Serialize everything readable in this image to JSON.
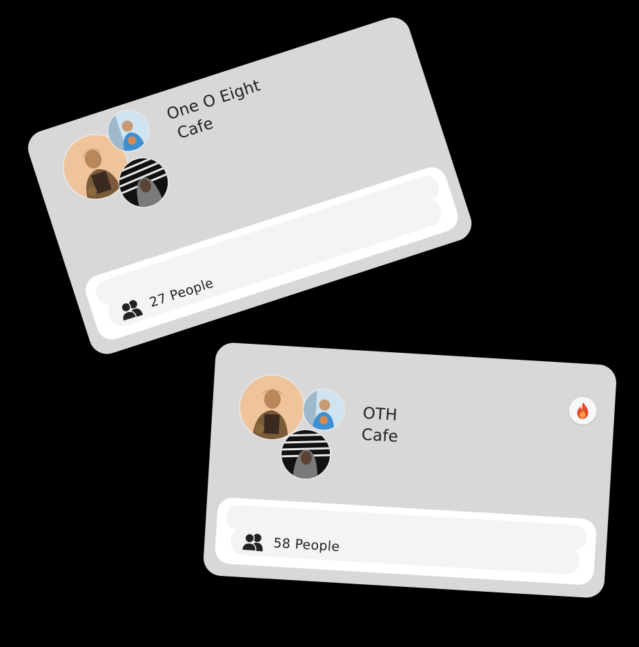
{
  "cards": [
    {
      "venue_line1": "One O Eight",
      "venue_line2": "Cafe",
      "people_count": "27 People",
      "hot": false
    },
    {
      "venue_line1": "OTH",
      "venue_line2": "Cafe",
      "people_count": "58 People",
      "hot": true
    }
  ],
  "icons": {
    "people": "people-icon",
    "hot": "fire-icon"
  },
  "colors": {
    "card_bg": "#d8d8d8",
    "footer_bg": "#ffffff",
    "text": "#1f1f1f",
    "fire": "#e8472a"
  }
}
